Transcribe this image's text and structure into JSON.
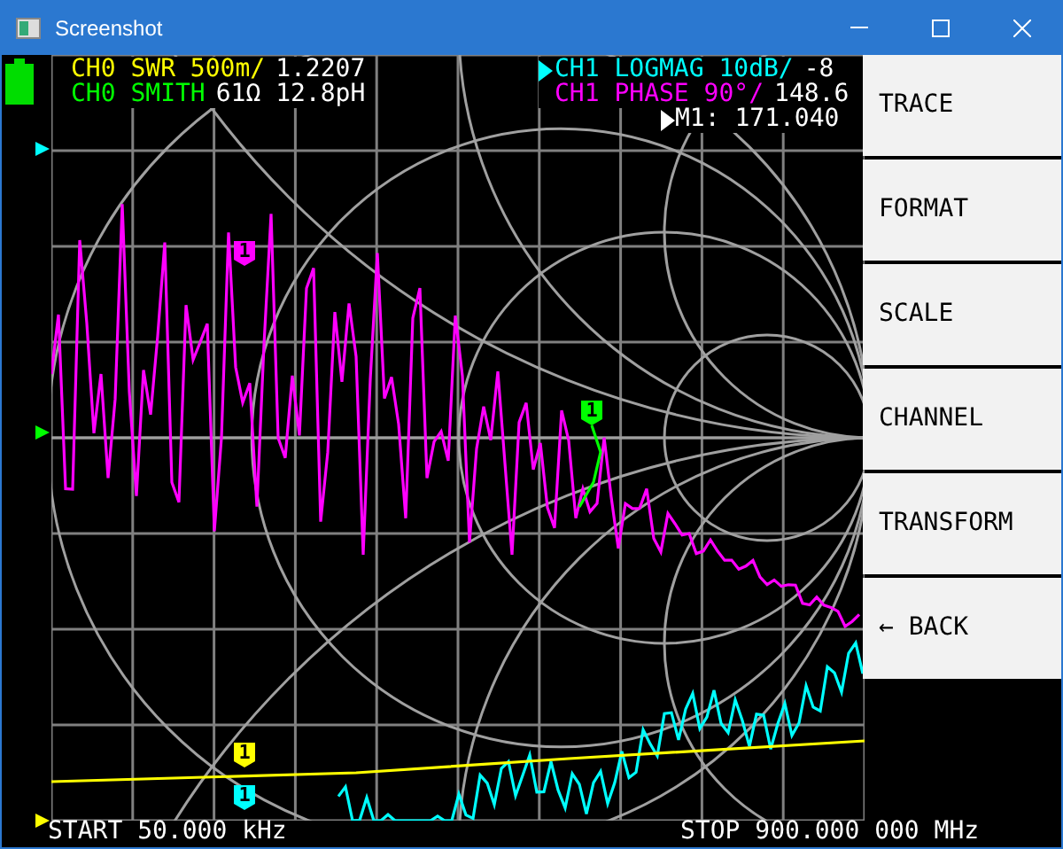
{
  "window": {
    "title": "Screenshot"
  },
  "left_trace_labels": [
    {
      "text": "CH0 SWR 500m/",
      "value": "1.2207",
      "color": "#ffff00"
    },
    {
      "text": "CH0 SMITH",
      "value": "61Ω 12.8pH",
      "color": "#00ff00"
    }
  ],
  "right_trace_labels": [
    {
      "text": "CH1 LOGMAG 10dB/",
      "value": "-8",
      "color": "#00ffff",
      "active": true
    },
    {
      "text": "CH1 PHASE 90°/",
      "value": "148.6",
      "color": "#ff00ff",
      "active": false
    }
  ],
  "marker_readout": "M1: 171.040",
  "markers": [
    {
      "label": "1",
      "color": "#ff00ff"
    },
    {
      "label": "1",
      "color": "#00ff00"
    },
    {
      "label": "1",
      "color": "#ffff00"
    },
    {
      "label": "1",
      "color": "#00ffff"
    }
  ],
  "sweep": {
    "start": "START 50.000 kHz",
    "stop": "STOP 900.000 000 MHz"
  },
  "menu": [
    {
      "label": "TRACE"
    },
    {
      "label": "FORMAT"
    },
    {
      "label": "SCALE"
    },
    {
      "label": "CHANNEL"
    },
    {
      "label": "TRANSFORM"
    },
    {
      "label": "← BACK"
    }
  ]
}
